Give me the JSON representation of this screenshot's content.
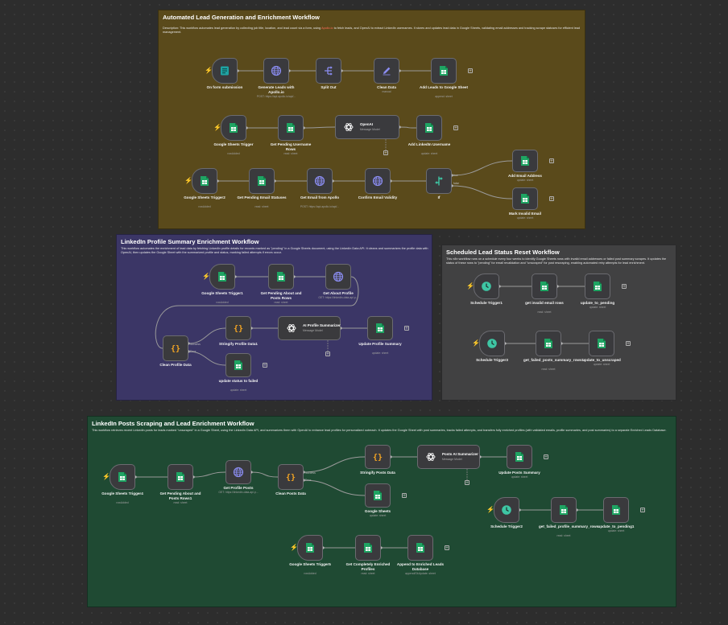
{
  "stickies": {
    "s1": {
      "title": "Automated Lead Generation and Enrichment Workflow",
      "desc_prefix": "Description: This workflow automates lead generation by collecting job title, location, and lead count via a form, using ",
      "desc_link": "Apollo.io",
      "desc_suffix": " to fetch leads, and OpenAI to extract LinkedIn usernames. It stores and updates lead data in Google Sheets, validating email addresses and tracking scrape statuses for efficient lead management."
    },
    "s2": {
      "title": "LinkedIn Profile Summary Enrichment Workflow",
      "desc": "This workflow automates the enrichment of lead data by fetching LinkedIn profile details for records marked as \"pending\" in a Google Sheets document, using the LinkedIn Data API. It cleans and summarizes the profile data with OpenAI, then updates the Google Sheet with the summarized profile and status, marking failed attempts if errors occur."
    },
    "s3": {
      "title": "Scheduled Lead Status Reset Workflow",
      "desc": "This n8n workflow runs on a schedule every four weeks to identify Google Sheets rows with invalid email addresses or failed post summary scrapes. It updates the status of these rows to \"pending\" for email revalidation and \"unscraped\" for post rescraping, enabling automated retry attempts for lead enrichment."
    },
    "s4": {
      "title": "LinkedIn Posts Scraping and Lead Enrichment Workflow",
      "desc": "This workflow retrieves recent LinkedIn posts for leads marked \"unscraped\" in a Google Sheet, using the LinkedIn Data API, and summarizes them with OpenAI to enhance lead profiles for personalized outreach. It updates the Google Sheet with post summaries, tracks failed attempts, and transfers fully enriched profiles (with validated emails, profile summaries, and post summaries) to a separate Enriched Leads Database."
    }
  },
  "nodes": {
    "form_trigger": {
      "label": "On form submission",
      "sub": ""
    },
    "apollo_generate": {
      "label": "Generate Leads with Apollo.io",
      "sub": "POST: https://api.apollo.io/api/..."
    },
    "split_out": {
      "label": "Split Out",
      "sub": ""
    },
    "clean_data": {
      "label": "Clean Data",
      "sub": "manual"
    },
    "add_leads": {
      "label": "Add Leads to Google Sheet",
      "sub": "append: sheet"
    },
    "gs_trigger": {
      "label": "Google Sheets Trigger",
      "sub": "rowAdded"
    },
    "pending_username": {
      "label": "Get Pending Username Rows",
      "sub": "read: sheet"
    },
    "openai1": {
      "label": "OpenAI",
      "sub": "Message Model"
    },
    "add_linkedin": {
      "label": "Add LinkedIn Username",
      "sub": "update: sheet"
    },
    "gs_trigger2": {
      "label": "Google Sheets Trigger2",
      "sub": "rowAdded"
    },
    "pending_email": {
      "label": "Get Pending Email Statuses",
      "sub": "read: sheet"
    },
    "email_apollo": {
      "label": "Get Email from Apollo",
      "sub": "POST: https://api.apollo.io/api/..."
    },
    "confirm_email": {
      "label": "Confirm Email Validity",
      "sub": ""
    },
    "if_node": {
      "label": "If",
      "sub": "",
      "true_label": "true",
      "false_label": "false"
    },
    "add_email": {
      "label": "Add Email Address",
      "sub": "update: sheet"
    },
    "mark_invalid": {
      "label": "Mark Invalid Email",
      "sub": "update: sheet"
    },
    "gs_trigger1": {
      "label": "Google Sheets Trigger1",
      "sub": "rowAdded"
    },
    "pending_about": {
      "label": "Get Pending About and Posts Rows",
      "sub": "read: sheet"
    },
    "about_profile": {
      "label": "Get About Profile",
      "sub": "GET: https://linkedin-data-api.p..."
    },
    "clean_profile": {
      "label": "Clean Profile Data",
      "sub": "",
      "success_label": "Success",
      "error_label": "Error"
    },
    "stringify_profile": {
      "label": "Stringify Profile Data1",
      "sub": ""
    },
    "ai_profile": {
      "label": "AI Profile Summarizer",
      "sub": "Message Model"
    },
    "update_profile": {
      "label": "Update Profile Summary",
      "sub": "update: sheet"
    },
    "update_failed": {
      "label": "update status to failed",
      "sub": "update: sheet"
    },
    "schedule1": {
      "label": "Schedule Trigger1",
      "sub": ""
    },
    "invalid_rows": {
      "label": "get invalid email rows",
      "sub": "read: sheet"
    },
    "update_pending": {
      "label": "update_to_pending",
      "sub": "update: sheet"
    },
    "schedule3": {
      "label": "Schedule Trigger3",
      "sub": ""
    },
    "failed_posts": {
      "label": "get_failed_posts_summary_rows1",
      "sub": "read: sheet"
    },
    "update_unscraped": {
      "label": "update_to_unscraped",
      "sub": "update: sheet"
    },
    "gs_trigger4": {
      "label": "Google Sheets Trigger4",
      "sub": "rowAdded"
    },
    "pending_about1": {
      "label": "Get Pending About and Posts Rows1",
      "sub": "read: sheet"
    },
    "profile_posts": {
      "label": "Get Profile Posts",
      "sub": "GET: https://linkedin-data-api.p..."
    },
    "clean_posts": {
      "label": "Clean Posts Data",
      "sub": "",
      "success_label": "Success",
      "error_label": "Error"
    },
    "stringify_posts": {
      "label": "Stringify Posts Data",
      "sub": ""
    },
    "posts_ai": {
      "label": "Posts AI Summarizer",
      "sub": "Message Model"
    },
    "update_posts": {
      "label": "Update Posts Summary",
      "sub": "update: sheet"
    },
    "google_sheets": {
      "label": "Google Sheets",
      "sub": "update: sheet"
    },
    "schedule2": {
      "label": "Schedule Trigger2",
      "sub": ""
    },
    "failed_profile": {
      "label": "get_failed_profile_summary_rows",
      "sub": "read: sheet"
    },
    "update_pending1": {
      "label": "update_to_pending1",
      "sub": "update: sheet"
    },
    "gs_trigger5": {
      "label": "Google Sheets Trigger5",
      "sub": "rowAdded"
    },
    "enriched_profiles": {
      "label": "Get Completely Enriched Profiles",
      "sub": "read: sheet"
    },
    "append_db": {
      "label": "Append to Enriched Leads Database",
      "sub": "append/OkUpdate: sheet"
    }
  },
  "icons": {
    "form": "form-icon",
    "http": "globe-icon",
    "split": "split-out-icon",
    "edit": "pencil-icon",
    "sheets": "google-sheets-icon",
    "openai": "openai-icon",
    "if": "if-icon",
    "code": "code-icon",
    "schedule": "clock-icon"
  },
  "colors": {
    "canvas": "#2d2d2d",
    "sticky_yellow": "#5a4a1b",
    "sticky_purple": "#3b3666",
    "sticky_gray": "#414142",
    "sticky_green": "#1f4a33",
    "node_bg": "#3a3a3d",
    "wire": "#9a9a9a",
    "trigger_bolt": "#ff6d5a",
    "sheets_green": "#1fa463",
    "globe_purple": "#8a8cf0",
    "code_orange": "#f5a623",
    "clock_teal": "#3ec6a4",
    "link_red": "#ff6d5a"
  }
}
